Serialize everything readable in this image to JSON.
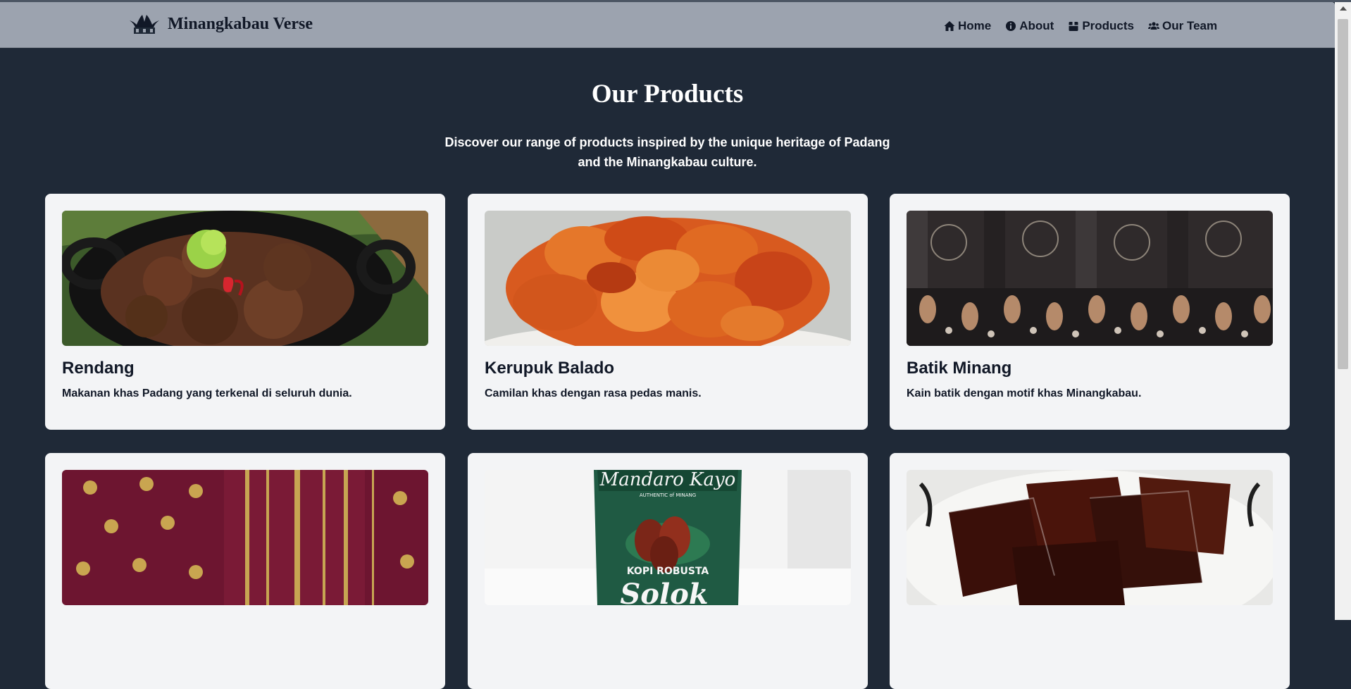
{
  "navbar": {
    "brand_name": "Minangkabau Verse",
    "brand_icon": "rumah-gadang-icon",
    "items": [
      {
        "label": "Home",
        "icon": "home-icon"
      },
      {
        "label": "About",
        "icon": "info-icon"
      },
      {
        "label": "Products",
        "icon": "box-icon"
      },
      {
        "label": "Our Team",
        "icon": "users-icon"
      }
    ]
  },
  "main": {
    "title": "Our Products",
    "subtitle": "Discover our range of products inspired by the unique heritage of Padang and the Minangkabau culture.",
    "products": [
      {
        "name": "Rendang",
        "description": "Makanan khas Padang yang terkenal di seluruh dunia."
      },
      {
        "name": "Kerupuk Balado",
        "description": "Camilan khas dengan rasa pedas manis."
      },
      {
        "name": "Batik Minang",
        "description": "Kain batik dengan motif khas Minangkabau."
      },
      {
        "name": "",
        "description": ""
      },
      {
        "name": "",
        "description": "",
        "package_text": [
          "Mandaro Kayo",
          "AUTHENTIC of MINANG",
          "KOPI ROBUSTA",
          "Solok"
        ]
      },
      {
        "name": "",
        "description": ""
      }
    ]
  },
  "colors": {
    "page_bg": "#1f2937",
    "navbar_bg": "#9ca3af",
    "card_bg": "#f3f4f6",
    "text_dark": "#111827"
  }
}
